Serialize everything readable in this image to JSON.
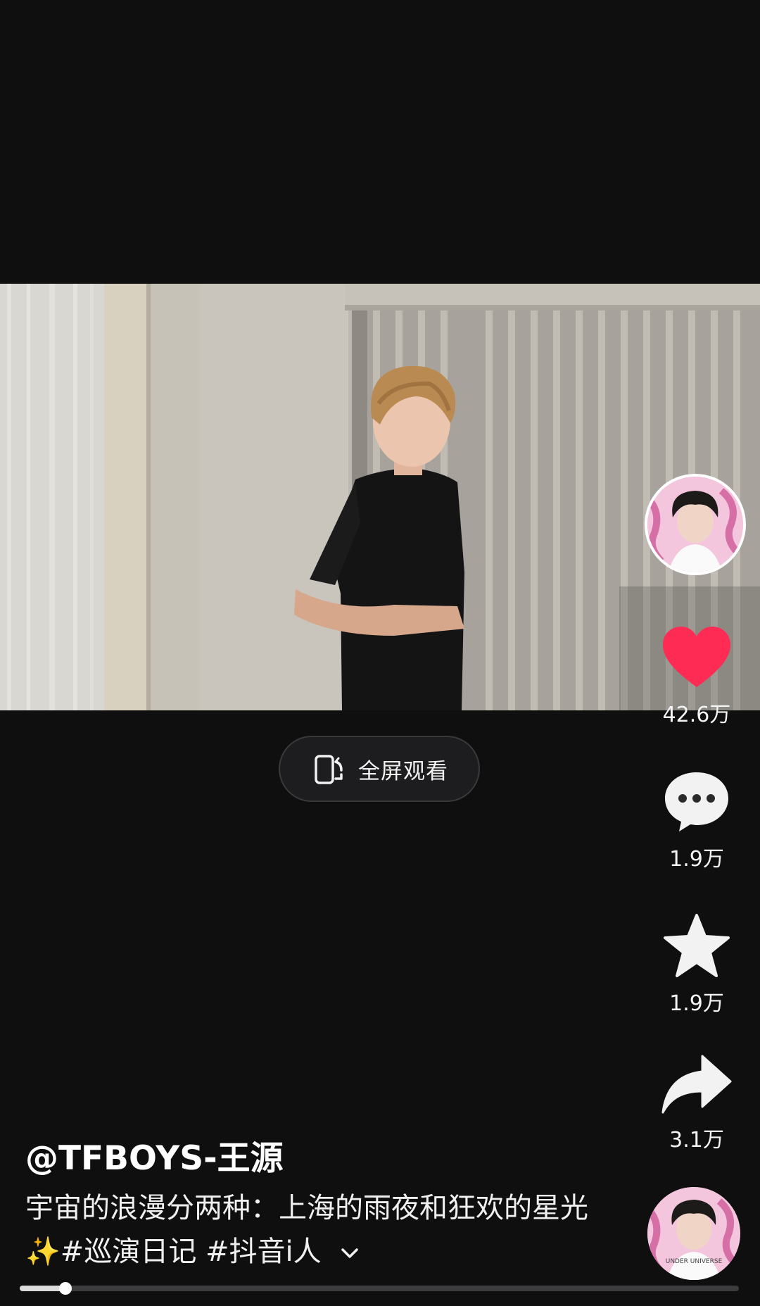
{
  "fullscreen": {
    "label": "全屏观看",
    "icon": "rotate-screen-icon"
  },
  "actions": {
    "likes": {
      "icon": "heart-icon",
      "count": "42.6万",
      "color": "#fe2c55"
    },
    "comments": {
      "icon": "comment-bubble-icon",
      "count": "1.9万"
    },
    "favorites": {
      "icon": "star-icon",
      "count": "1.9万"
    },
    "shares": {
      "icon": "share-arrow-icon",
      "count": "3.1万"
    }
  },
  "author": {
    "handle": "@TFBOYS-王源"
  },
  "caption": {
    "text": "宇宙的浪漫分两种：上海的雨夜和狂欢的星光✨#巡演日记 #抖音i人",
    "expand_icon": "chevron-down-icon"
  },
  "playback": {
    "progress": 0.064
  },
  "avatar_badge_text": "UNDER UNIVERSE"
}
